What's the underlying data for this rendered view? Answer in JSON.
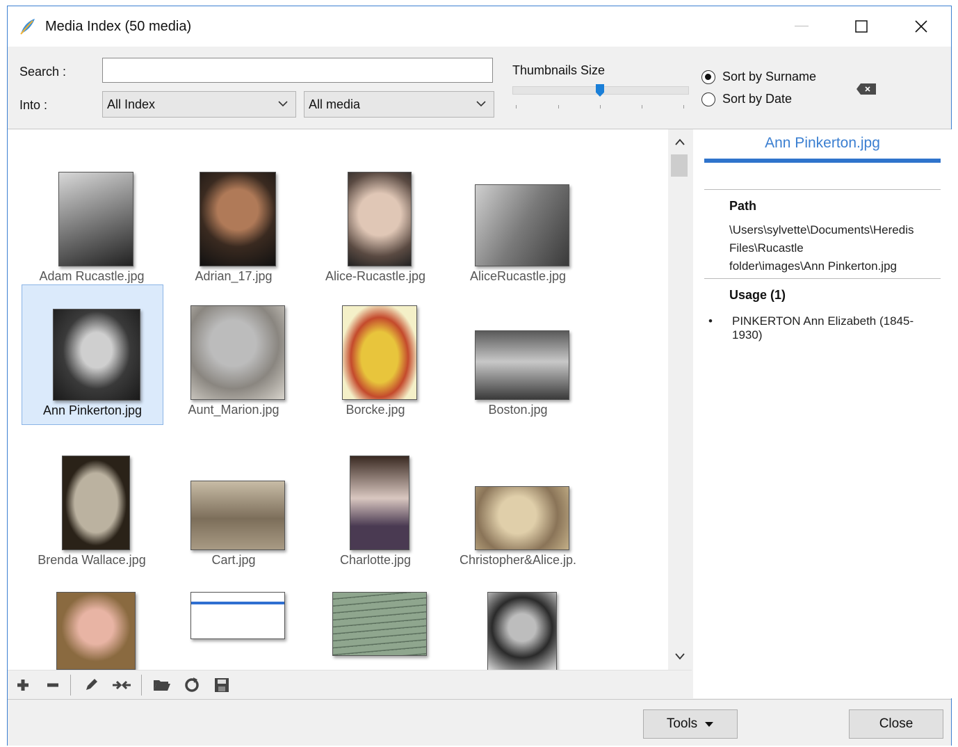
{
  "window": {
    "title": "Media Index (50 media)"
  },
  "toolbar": {
    "search_label": "Search :",
    "search_value": "",
    "into_label": "Into :",
    "into_index_value": "All Index",
    "into_media_value": "All media",
    "thumbnail_size_label": "Thumbnails Size",
    "thumbnail_size_level": 0.5,
    "sort_surname_label": "Sort by Surname",
    "sort_date_label": "Sort by Date",
    "sort_selected": "surname"
  },
  "media": [
    {
      "name": "Adam Rucastle.jpg",
      "selected": false
    },
    {
      "name": "Adrian_17.jpg",
      "selected": false
    },
    {
      "name": "Alice-Rucastle.jpg",
      "selected": false
    },
    {
      "name": "AliceRucastle.jpg",
      "selected": false
    },
    {
      "name": "Ann Pinkerton.jpg",
      "selected": true
    },
    {
      "name": "Aunt_Marion.jpg",
      "selected": false
    },
    {
      "name": "Borcke.jpg",
      "selected": false
    },
    {
      "name": "Boston.jpg",
      "selected": false
    },
    {
      "name": "Brenda Wallace.jpg",
      "selected": false
    },
    {
      "name": "Cart.jpg",
      "selected": false
    },
    {
      "name": "Charlotte.jpg",
      "selected": false
    },
    {
      "name": "Christopher&Alice.jp.",
      "selected": false
    }
  ],
  "detail": {
    "title": "Ann Pinkerton.jpg",
    "path_label": "Path",
    "path_line1": "\\Users\\sylvette\\Documents\\Heredis",
    "path_line2": "Files\\Rucastle",
    "path_line3": "folder\\images\\Ann Pinkerton.jpg",
    "usage_label": "Usage (1)",
    "usage_items": [
      "PINKERTON Ann Elizabeth (1845-1930)"
    ]
  },
  "footer": {
    "tools_label": "Tools",
    "close_label": "Close"
  },
  "colors": {
    "accent": "#3b7fd1",
    "selection_bg": "#dbeafb",
    "slider": "#1a7fd8"
  }
}
